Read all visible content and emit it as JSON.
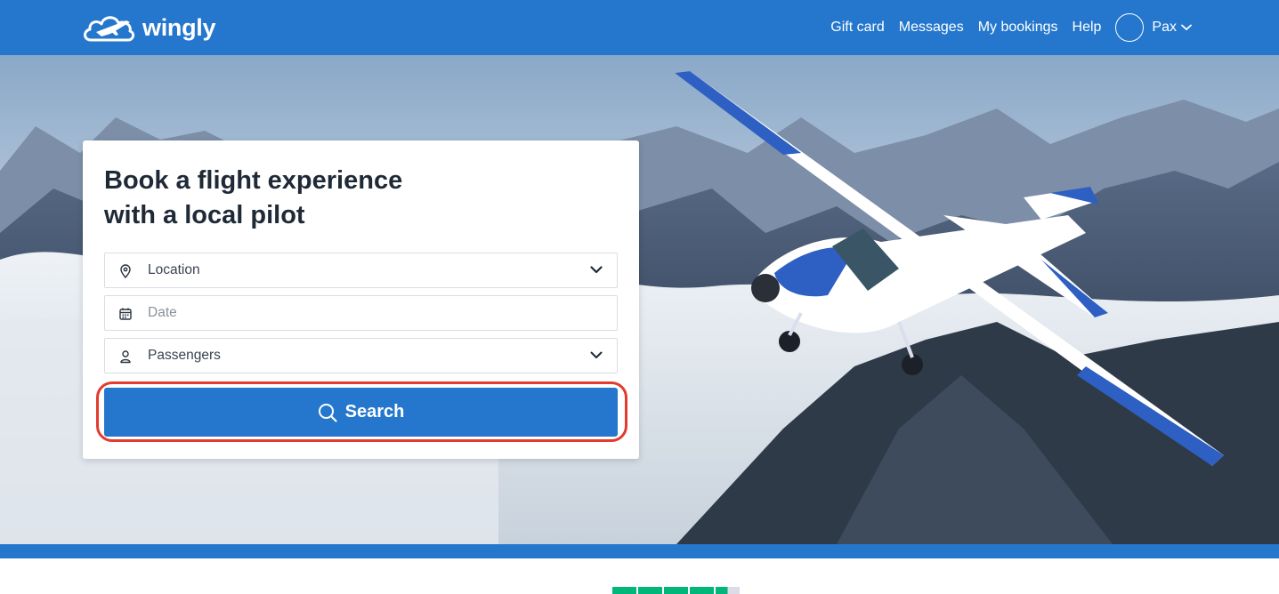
{
  "brand": {
    "name": "wingly",
    "logo_icon": "cloud-plane-icon"
  },
  "nav": {
    "links": [
      "Gift card",
      "Messages",
      "My bookings",
      "Help"
    ],
    "user_name": "Pax",
    "avatar_icon": "avatar-circle-icon"
  },
  "hero": {
    "title_line1": "Book a flight experience",
    "title_line2": "with a local pilot"
  },
  "form": {
    "location": {
      "placeholder": "Location",
      "icon": "location-pin-icon"
    },
    "date": {
      "placeholder": "Date",
      "icon": "calendar-icon"
    },
    "passengers": {
      "placeholder": "Passengers",
      "icon": "person-icon"
    },
    "search_label": "Search"
  },
  "rating": {
    "stars": 4.5,
    "max": 5
  },
  "colors": {
    "primary": "#2477cd",
    "highlight": "#e33b2e",
    "rating": "#00b67a",
    "title": "#1f2a37"
  }
}
